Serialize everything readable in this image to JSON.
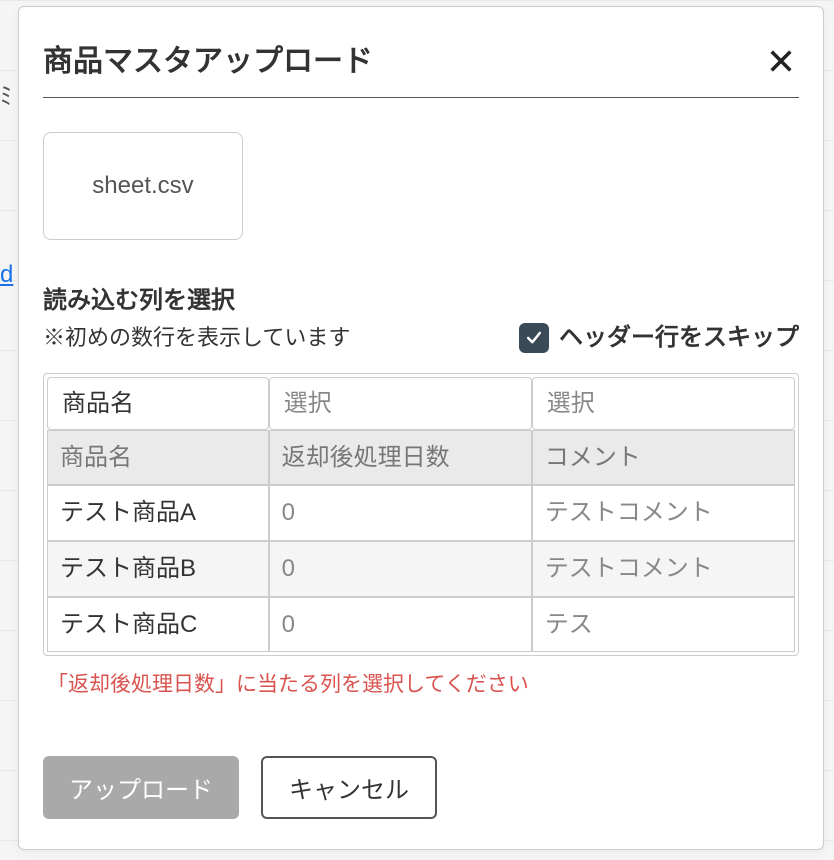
{
  "modal": {
    "title": "商品マスタアップロード",
    "file_name": "sheet.csv",
    "section_title": "読み込む列を選択",
    "subtitle": "※初めの数行を表示しています",
    "skip_header_label": "ヘッダー行をスキップ",
    "skip_header_checked": true,
    "select_placeholder": "選択",
    "column_selects": [
      "商品名",
      "",
      ""
    ],
    "preview_headers": [
      "商品名",
      "返却後処理日数",
      "コメント"
    ],
    "preview_rows": [
      [
        "テスト商品A",
        "0",
        "テストコメント"
      ],
      [
        "テスト商品B",
        "0",
        "テストコメント"
      ],
      [
        "テスト商品C",
        "0",
        "テス"
      ]
    ],
    "error": "「返却後処理日数」に当たる列を選択してください",
    "upload_label": "アップロード",
    "cancel_label": "キャンセル"
  },
  "background": {
    "link_fragment": "d"
  }
}
